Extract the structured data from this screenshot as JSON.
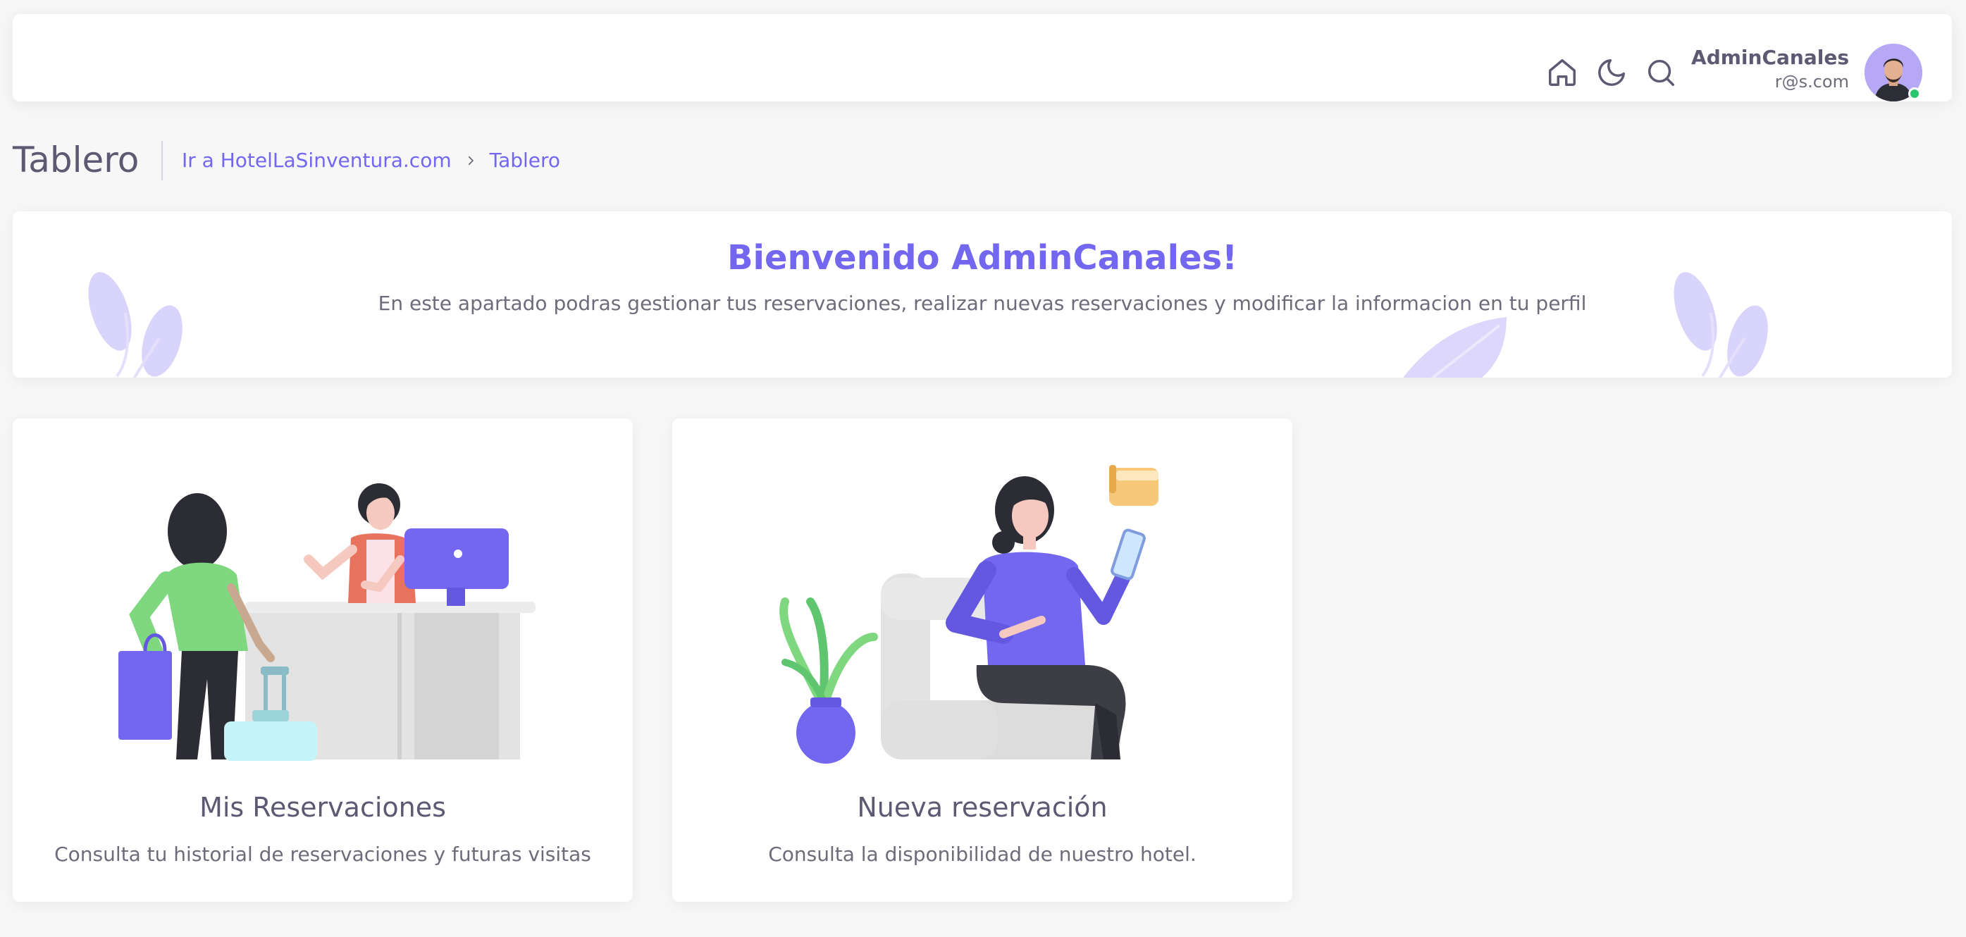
{
  "navbar": {
    "icons": [
      "home-icon",
      "moon-icon",
      "search-icon"
    ],
    "user": {
      "name": "AdminCanales",
      "email": "r@s.com",
      "status_color": "#28c76f"
    }
  },
  "header": {
    "title": "Tablero",
    "breadcrumb": {
      "link": "Ir a HotelLaSinventura.com",
      "separator_icon": "chevron-right-icon",
      "current": "Tablero"
    }
  },
  "welcome": {
    "title": "Bienvenido AdminCanales!",
    "text": "En este apartado podras gestionar tus reservaciones, realizar nuevas reservaciones y modificar la informacion en tu perfil"
  },
  "cards": [
    {
      "title": "Mis Reservaciones",
      "text": "Consulta tu historial de reservaciones y futuras visitas"
    },
    {
      "title": "Nueva reservación",
      "text": "Consulta la disponibilidad de nuestro hotel."
    }
  ],
  "colors": {
    "accent": "#7367f0",
    "background": "#f7f7f7",
    "card": "#ffffff",
    "online": "#28c76f"
  }
}
